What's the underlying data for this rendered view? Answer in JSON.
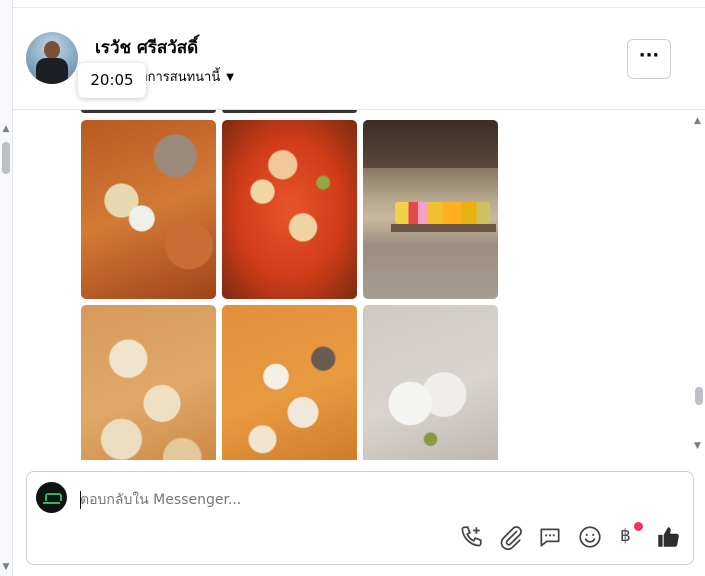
{
  "header": {
    "name": "เรวัช ศรีสวัสดิ์",
    "subtitle": "ยการสนทนานี้",
    "tooltip_time": "20:05",
    "more_label": "···"
  },
  "messages": {
    "photos": [
      {
        "description": "food-photo-1"
      },
      {
        "description": "food-photo-2"
      },
      {
        "description": "market-stall-photo"
      },
      {
        "description": "food-photo-4"
      },
      {
        "description": "food-photo-5"
      },
      {
        "description": "food-photo-6"
      }
    ]
  },
  "composer": {
    "placeholder": "ตอบกลับใน Messenger...",
    "baht_symbol": "฿",
    "icons": [
      "call-add-icon",
      "attachment-icon",
      "chat-bubble-icon",
      "emoji-icon",
      "baht-icon",
      "thumbs-up-icon"
    ]
  },
  "colors": {
    "accent": "#e8385a",
    "border": "#ccd0d5"
  }
}
